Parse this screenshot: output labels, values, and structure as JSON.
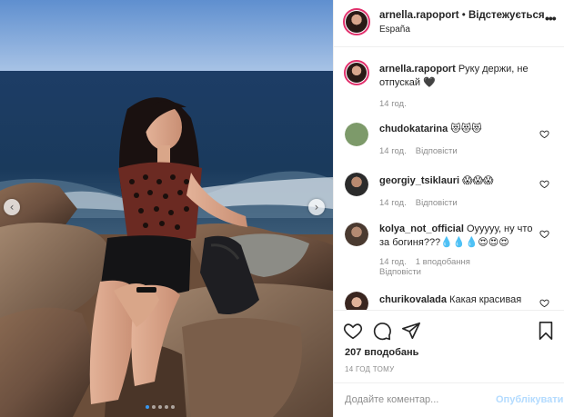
{
  "photo": {
    "carousel_dots": 5,
    "active_dot": 0,
    "prev_glyph": "‹",
    "next_glyph": "›"
  },
  "header": {
    "username": "arnella.rapoport",
    "separator": " • ",
    "follow_status": "Відстежується",
    "location": "España",
    "more_glyph": "•••"
  },
  "caption": {
    "username": "arnella.rapoport",
    "text": "Руку держи, не отпускай 🖤",
    "time": "14 год."
  },
  "comments": [
    {
      "username": "chudokatarina",
      "text": "😻😻😻",
      "time": "14 год.",
      "reply_label": "Відповісти",
      "likes": "",
      "avatar_color": "#7d9a6a"
    },
    {
      "username": "georgiy_tsiklauri",
      "text": "😱😱😱",
      "time": "14 год.",
      "reply_label": "Відповісти",
      "likes": "",
      "avatar_color": "#3a3a3a"
    },
    {
      "username": "kolya_not_official",
      "text": "Оууууу, ну что за богиня???💧💧💧😍😍😍",
      "time": "14 год.",
      "reply_label": "Відповісти",
      "likes": "1 вподобання",
      "avatar_color": "#5b4a3f"
    },
    {
      "username": "churikovalada",
      "text": "Какая красивая",
      "time": "",
      "reply_label": "",
      "likes": "",
      "avatar_color": "#c98d76"
    }
  ],
  "actions": {
    "likes_count": "207 вподобань",
    "time_ago": "14 ГОД ТОМУ"
  },
  "add_comment": {
    "placeholder": "Додайте коментар...",
    "publish_label": "Опублікувати"
  },
  "colors": {
    "link_blue": "#3897f0",
    "publish_disabled": "#b3dbff",
    "story_ring": "#e1306c",
    "secondary_text": "#8e8e8e"
  },
  "icons": [
    "heart-icon",
    "comment-icon",
    "share-icon",
    "bookmark-icon",
    "chevron-left-icon",
    "chevron-right-icon",
    "more-options-icon"
  ]
}
